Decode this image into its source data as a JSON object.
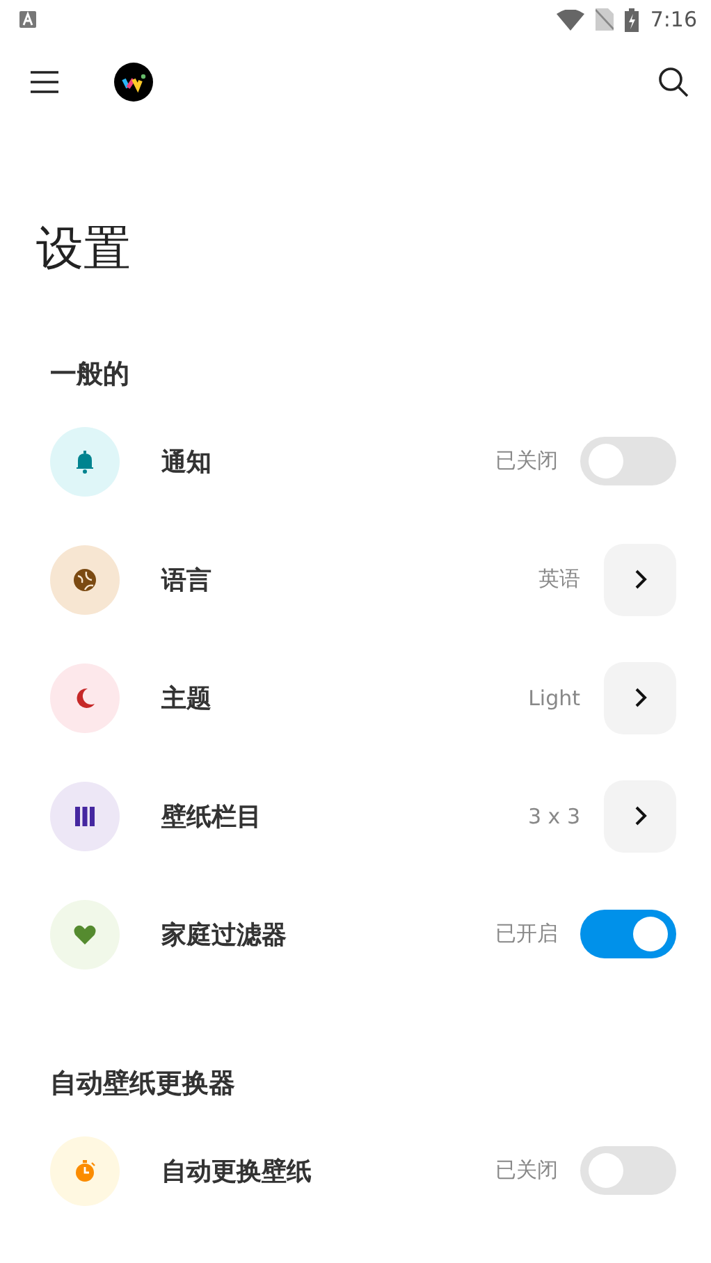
{
  "status_bar": {
    "time": "7:16"
  },
  "title": "设置",
  "sections": [
    {
      "header": "一般的",
      "rows": [
        {
          "kind": "toggle",
          "label": "通知",
          "value": "已关闭",
          "on": false
        },
        {
          "kind": "link",
          "label": "语言",
          "value": "英语"
        },
        {
          "kind": "link",
          "label": "主题",
          "value": "Light"
        },
        {
          "kind": "link",
          "label": "壁纸栏目",
          "value": "3 x 3"
        },
        {
          "kind": "toggle",
          "label": "家庭过滤器",
          "value": "已开启",
          "on": true
        }
      ]
    },
    {
      "header": "自动壁纸更换器",
      "rows": [
        {
          "kind": "toggle",
          "label": "自动更换壁纸",
          "value": "已关闭",
          "on": false
        }
      ]
    }
  ]
}
